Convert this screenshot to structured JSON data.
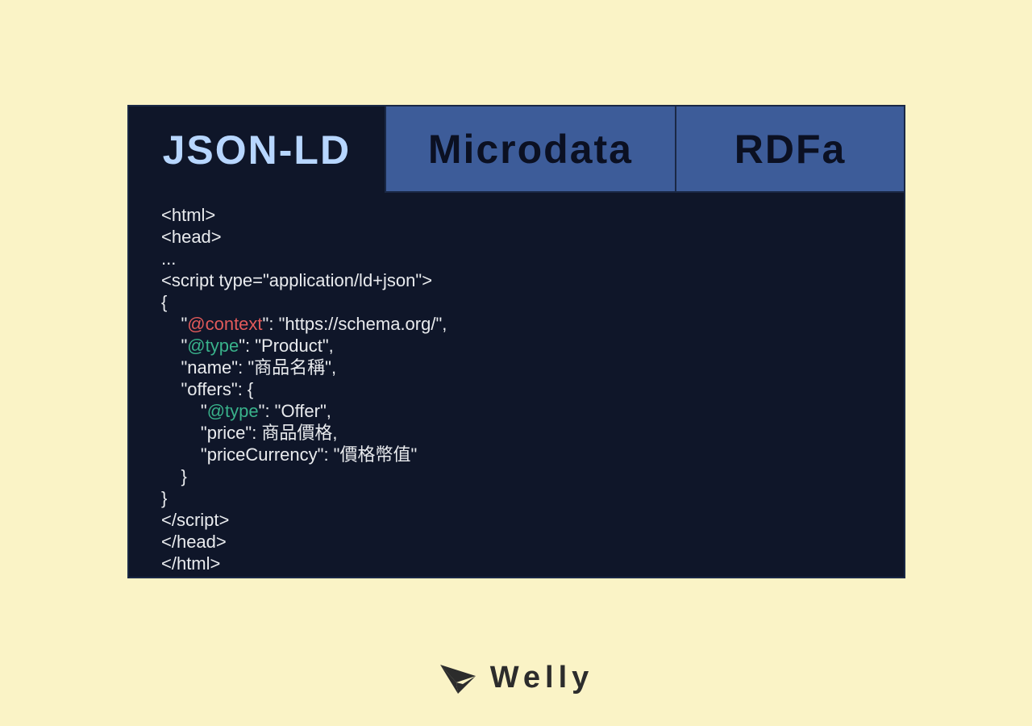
{
  "tabs": {
    "a": "JSON-LD",
    "b": "Microdata",
    "c": "RDFa"
  },
  "code": {
    "l01": "<html>",
    "l02": "<head>",
    "l03": "...",
    "l04": "<script type=\"application/ld+json\">",
    "l05": "{",
    "l06a": "    \"",
    "l06b": "@context",
    "l06c": "\": \"https://schema.org/\",",
    "l07a": "    \"",
    "l07b": "@type",
    "l07c": "\": \"Product\",",
    "l08": "    \"name\": \"商品名稱\",",
    "l09": "    \"offers\": {",
    "l10a": "        \"",
    "l10b": "@type",
    "l10c": "\": \"Offer\",",
    "l11": "        \"price\": 商品價格,",
    "l12": "        \"priceCurrency\": \"價格幣值\"",
    "l13": "    }",
    "l14": "}",
    "l15": "</script>",
    "l16": "</head>",
    "l17": "</html>"
  },
  "brand": {
    "name": "Welly"
  }
}
